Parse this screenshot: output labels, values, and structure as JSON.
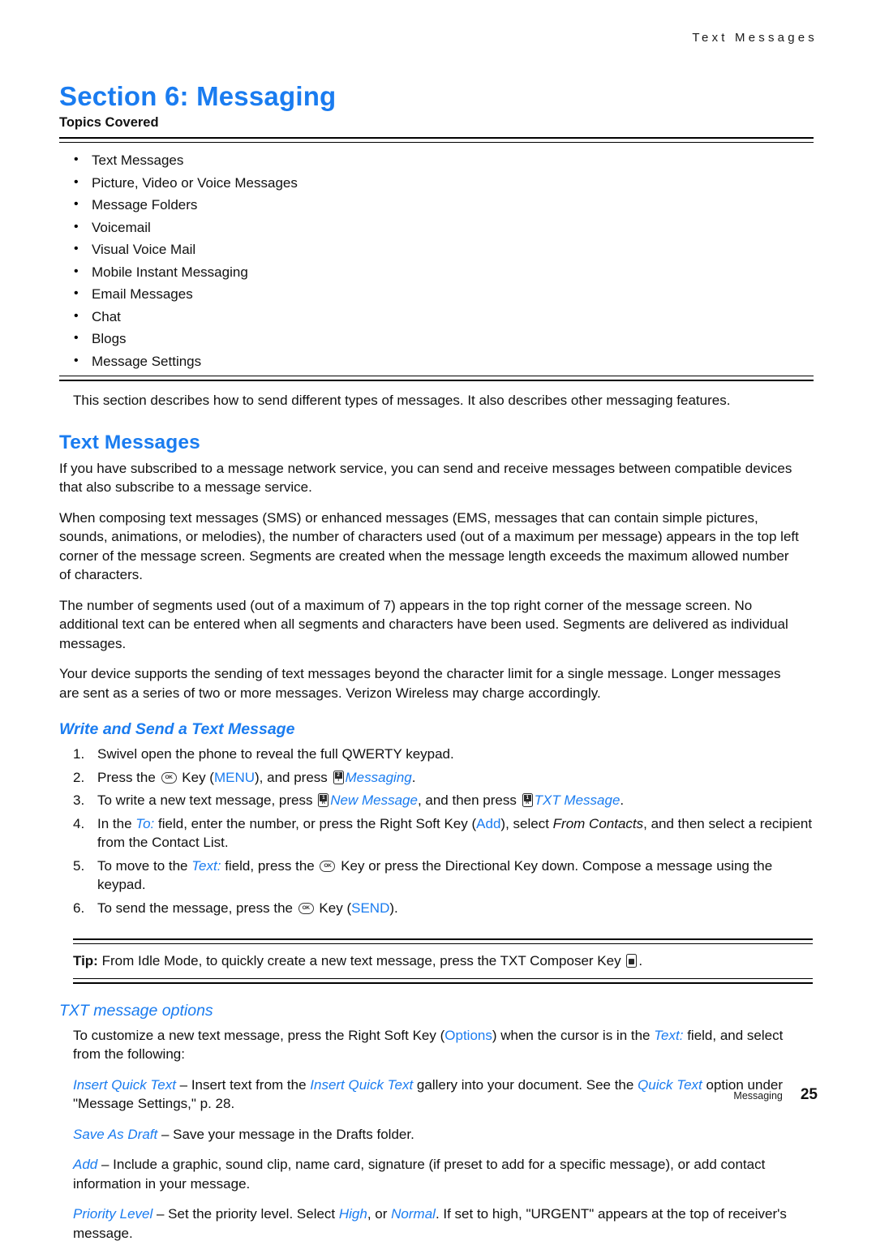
{
  "header": {
    "running_title": "Text Messages"
  },
  "section": {
    "title": "Section 6:  Messaging",
    "topics_label": "Topics Covered",
    "topics": [
      "Text Messages",
      "Picture, Video or Voice Messages",
      "Message Folders",
      "Voicemail",
      "Visual Voice Mail",
      "Mobile Instant Messaging",
      "Email Messages",
      "Chat",
      "Blogs",
      "Message Settings"
    ],
    "intro": "This section describes how to send different types of messages. It also describes other messaging features."
  },
  "text_messages": {
    "heading": "Text Messages",
    "paragraphs": [
      "If you have subscribed to a message network service, you can send and receive messages between compatible devices that also subscribe to a message service.",
      "When composing text messages (SMS) or enhanced messages (EMS, messages that can contain simple pictures, sounds, animations, or melodies), the number of characters used (out of a maximum per message) appears in the top left corner of the message screen. Segments are created when the message length exceeds the maximum allowed number of characters.",
      "The number of segments used (out of a maximum of 7) appears in the top right corner of the message screen. No additional text can be entered when all segments and characters have been used. Segments are delivered as individual messages.",
      "Your device supports the sending of text messages beyond the character limit for a single message. Longer messages are sent as a series of two or more messages. Verizon Wireless may charge accordingly."
    ]
  },
  "write_send": {
    "heading": "Write and Send a Text Message",
    "steps": [
      {
        "parts": [
          {
            "t": "text",
            "v": "Swivel open the phone to reveal the full QWERTY keypad."
          }
        ]
      },
      {
        "parts": [
          {
            "t": "text",
            "v": "Press the "
          },
          {
            "t": "key-ok",
            "v": "OK"
          },
          {
            "t": "text",
            "v": " Key ("
          },
          {
            "t": "blue",
            "v": "MENU"
          },
          {
            "t": "text",
            "v": "), and press "
          },
          {
            "t": "key-num",
            "v": "2 T"
          },
          {
            "t": "blue-i",
            "v": "Messaging"
          },
          {
            "t": "text",
            "v": "."
          }
        ]
      },
      {
        "parts": [
          {
            "t": "text",
            "v": "To write a new text message, press "
          },
          {
            "t": "key-num",
            "v": "1 R"
          },
          {
            "t": "blue-i",
            "v": "New Message"
          },
          {
            "t": "text",
            "v": ", and then press "
          },
          {
            "t": "key-num",
            "v": "1 R"
          },
          {
            "t": "blue-i",
            "v": "TXT Message"
          },
          {
            "t": "text",
            "v": "."
          }
        ]
      },
      {
        "parts": [
          {
            "t": "text",
            "v": "In the "
          },
          {
            "t": "blue-i",
            "v": "To:"
          },
          {
            "t": "text",
            "v": " field, enter the number, or press the Right Soft Key ("
          },
          {
            "t": "blue",
            "v": "Add"
          },
          {
            "t": "text",
            "v": "), select "
          },
          {
            "t": "ital",
            "v": "From Contacts"
          },
          {
            "t": "text",
            "v": ", and then select a recipient from the Contact List."
          }
        ]
      },
      {
        "parts": [
          {
            "t": "text",
            "v": "To move to the "
          },
          {
            "t": "blue-i",
            "v": "Text:"
          },
          {
            "t": "text",
            "v": " field, press the "
          },
          {
            "t": "key-ok",
            "v": "OK"
          },
          {
            "t": "text",
            "v": " Key or press the Directional Key down. Compose a message using the keypad."
          }
        ]
      },
      {
        "parts": [
          {
            "t": "text",
            "v": "To send the message, press the "
          },
          {
            "t": "key-ok",
            "v": "OK"
          },
          {
            "t": "text",
            "v": " Key ("
          },
          {
            "t": "blue",
            "v": "SEND"
          },
          {
            "t": "text",
            "v": ")."
          }
        ]
      }
    ]
  },
  "tip": {
    "label": "Tip:",
    "text_before": "From Idle Mode, to quickly create a new text message, press the TXT Composer Key",
    "text_after": "."
  },
  "txt_options": {
    "heading": "TXT message options",
    "intro_parts": [
      {
        "t": "text",
        "v": "To customize a new text message, press the Right Soft Key ("
      },
      {
        "t": "blue",
        "v": "Options"
      },
      {
        "t": "text",
        "v": ") when the cursor is in the "
      },
      {
        "t": "blue-i",
        "v": "Text:"
      },
      {
        "t": "text",
        "v": " field, and select from the following:"
      }
    ],
    "options": [
      {
        "parts": [
          {
            "t": "blue-i",
            "v": "Insert Quick Text"
          },
          {
            "t": "text",
            "v": " – Insert text from the "
          },
          {
            "t": "blue-i",
            "v": "Insert Quick Text"
          },
          {
            "t": "text",
            "v": " gallery into your document. See the "
          },
          {
            "t": "blue-i",
            "v": "Quick Text"
          },
          {
            "t": "text",
            "v": " option under \"Message Settings,\" p. 28."
          }
        ]
      },
      {
        "parts": [
          {
            "t": "blue-i",
            "v": "Save As Draft"
          },
          {
            "t": "text",
            "v": " – Save your message in the Drafts folder."
          }
        ]
      },
      {
        "parts": [
          {
            "t": "blue-i",
            "v": "Add"
          },
          {
            "t": "text",
            "v": " – Include a graphic, sound clip, name card, signature (if preset to add for a specific message), or add contact information in your message."
          }
        ]
      },
      {
        "parts": [
          {
            "t": "blue-i",
            "v": "Priority Level"
          },
          {
            "t": "text",
            "v": " – Set the priority level. Select "
          },
          {
            "t": "blue-i",
            "v": "High"
          },
          {
            "t": "text",
            "v": ", or "
          },
          {
            "t": "blue-i",
            "v": "Normal"
          },
          {
            "t": "text",
            "v": ". If set to high, \"URGENT\" appears at the top of receiver's message."
          }
        ]
      }
    ]
  },
  "footer": {
    "name": "Messaging",
    "page_number": "25"
  },
  "colors": {
    "accent_blue": "#1a7cf0",
    "body_text": "#111111"
  }
}
